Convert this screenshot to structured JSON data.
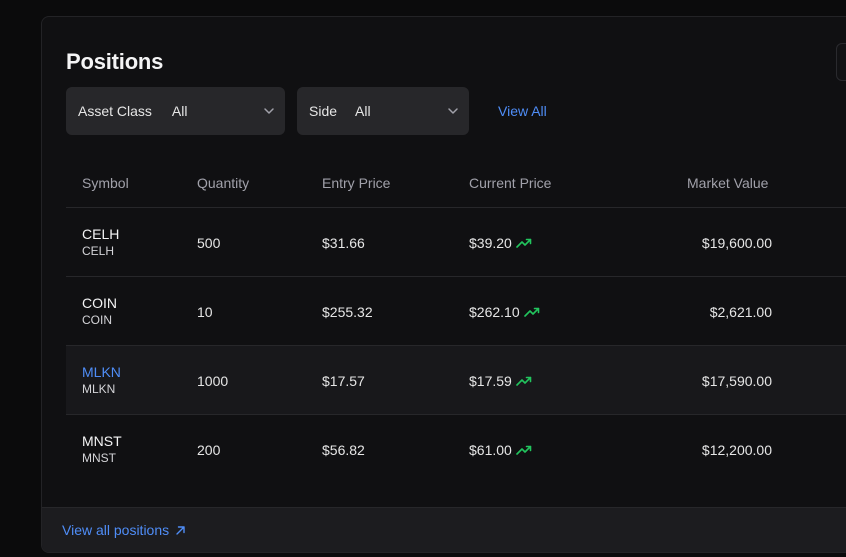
{
  "title": "Positions",
  "filters": {
    "asset_class": {
      "label": "Asset Class",
      "value": "All"
    },
    "side": {
      "label": "Side",
      "value": "All"
    },
    "view_all": "View All"
  },
  "table": {
    "columns": [
      "Symbol",
      "Quantity",
      "Entry Price",
      "Current Price",
      "Market Value"
    ],
    "rows": [
      {
        "symbol": "CELH",
        "sub": "CELH",
        "quantity": "500",
        "entry": "$31.66",
        "current": "$39.20",
        "trend": "up",
        "market_value": "$19,600.00",
        "highlighted": false
      },
      {
        "symbol": "COIN",
        "sub": "COIN",
        "quantity": "10",
        "entry": "$255.32",
        "current": "$262.10",
        "trend": "up",
        "market_value": "$2,621.00",
        "highlighted": false
      },
      {
        "symbol": "MLKN",
        "sub": "MLKN",
        "quantity": "1000",
        "entry": "$17.57",
        "current": "$17.59",
        "trend": "up",
        "market_value": "$17,590.00",
        "highlighted": true
      },
      {
        "symbol": "MNST",
        "sub": "MNST",
        "quantity": "200",
        "entry": "$56.82",
        "current": "$61.00",
        "trend": "up",
        "market_value": "$12,200.00",
        "highlighted": false
      }
    ]
  },
  "footer": {
    "link": "View all positions"
  },
  "colors": {
    "accent": "#4f8df7",
    "up": "#22c55e",
    "card": "#101012",
    "background": "#0b0b0c"
  },
  "icons": {
    "trend": "trending-up-icon",
    "chevron": "chevron-down-icon",
    "external": "arrow-up-right-icon"
  }
}
